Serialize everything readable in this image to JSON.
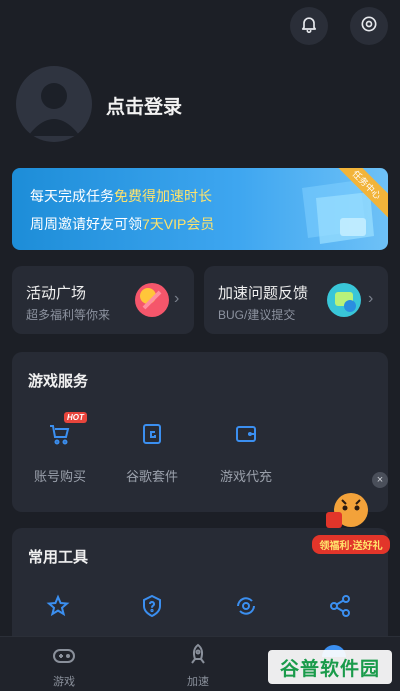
{
  "profile": {
    "login_label": "点击登录"
  },
  "banner": {
    "line1_prefix": "每天完成任务",
    "line1_highlight": "免费得加速时长",
    "line2_prefix": "周周邀请好友可领",
    "line2_highlight": "7天VIP会员",
    "ribbon": "任务中心"
  },
  "cards": [
    {
      "title": "活动广场",
      "subtitle": "超多福利等你来"
    },
    {
      "title": "加速问题反馈",
      "subtitle": "BUG/建议提交"
    }
  ],
  "game_services": {
    "title": "游戏服务",
    "items": [
      {
        "label": "账号购买",
        "badge": "HOT"
      },
      {
        "label": "谷歌套件"
      },
      {
        "label": "游戏代充"
      }
    ]
  },
  "common_tools": {
    "title": "常用工具"
  },
  "bottom_nav": {
    "items": [
      {
        "label": "游戏"
      },
      {
        "label": "加速"
      }
    ]
  },
  "promo": {
    "text": "领福利·送好礼"
  },
  "watermark": {
    "text": "谷普软件园"
  },
  "colors": {
    "background": "#1c1f26",
    "card": "#272b35",
    "accent_blue": "#3b8ff0",
    "banner_gradient_start": "#1d8dd8",
    "hot_badge": "#e8453c"
  }
}
